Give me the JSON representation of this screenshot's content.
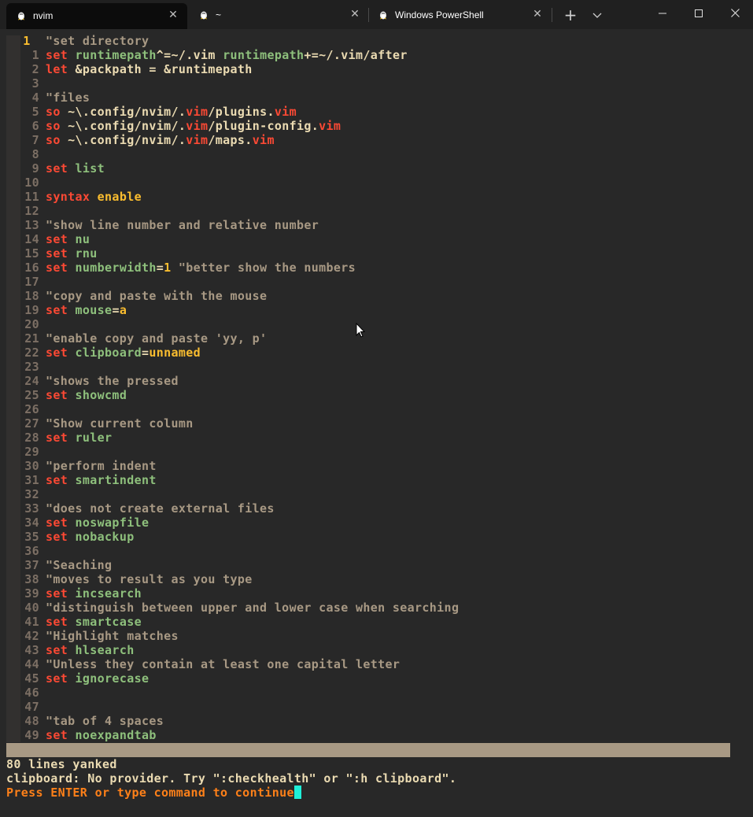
{
  "tabs": [
    {
      "label": "nvim",
      "active": true
    },
    {
      "label": "~",
      "active": false
    },
    {
      "label": "Windows PowerShell",
      "active": false
    }
  ],
  "colors": {
    "comment": "#a89984",
    "keyword": "#fb4934",
    "option": "#8ec07c",
    "value": "#fabd2f",
    "plain": "#ebdbb2",
    "linenr": "#7c6f64",
    "cursor": "#1ff0d8"
  },
  "editor": {
    "lines": [
      {
        "n": "1",
        "current": true,
        "parts": [
          [
            "c",
            "\"set directory"
          ]
        ]
      },
      {
        "n": "1",
        "parts": [
          [
            "k",
            "set "
          ],
          [
            "o",
            "runtimepath"
          ],
          [
            "p",
            "^=~/.vim "
          ],
          [
            "o",
            "runtimepath"
          ],
          [
            "p",
            "+=~/.vim/after"
          ]
        ]
      },
      {
        "n": "2",
        "parts": [
          [
            "k",
            "let "
          ],
          [
            "p",
            "&packpath = &runtimepath"
          ]
        ]
      },
      {
        "n": "3",
        "parts": []
      },
      {
        "n": "4",
        "parts": [
          [
            "c",
            "\"files"
          ]
        ]
      },
      {
        "n": "5",
        "parts": [
          [
            "k",
            "so "
          ],
          [
            "p",
            "~\\.config/nvim/."
          ],
          [
            "k",
            "vim"
          ],
          [
            "p",
            "/plugins."
          ],
          [
            "k",
            "vim"
          ]
        ]
      },
      {
        "n": "6",
        "parts": [
          [
            "k",
            "so "
          ],
          [
            "p",
            "~\\.config/nvim/."
          ],
          [
            "k",
            "vim"
          ],
          [
            "p",
            "/plugin-config."
          ],
          [
            "k",
            "vim"
          ]
        ]
      },
      {
        "n": "7",
        "parts": [
          [
            "k",
            "so "
          ],
          [
            "p",
            "~\\.config/nvim/."
          ],
          [
            "k",
            "vim"
          ],
          [
            "p",
            "/maps."
          ],
          [
            "k",
            "vim"
          ]
        ]
      },
      {
        "n": "8",
        "parts": []
      },
      {
        "n": "9",
        "parts": [
          [
            "k",
            "set "
          ],
          [
            "o",
            "list"
          ]
        ]
      },
      {
        "n": "10",
        "parts": []
      },
      {
        "n": "11",
        "parts": [
          [
            "k",
            "syntax "
          ],
          [
            "v",
            "enable"
          ]
        ]
      },
      {
        "n": "12",
        "parts": []
      },
      {
        "n": "13",
        "parts": [
          [
            "c",
            "\"show line number and relative number"
          ]
        ]
      },
      {
        "n": "14",
        "parts": [
          [
            "k",
            "set "
          ],
          [
            "o",
            "nu"
          ]
        ]
      },
      {
        "n": "15",
        "parts": [
          [
            "k",
            "set "
          ],
          [
            "o",
            "rnu"
          ]
        ]
      },
      {
        "n": "16",
        "parts": [
          [
            "k",
            "set "
          ],
          [
            "o",
            "numberwidth"
          ],
          [
            "p",
            "="
          ],
          [
            "v",
            "1"
          ],
          [
            "c",
            " \"better show the numbers"
          ]
        ]
      },
      {
        "n": "17",
        "parts": []
      },
      {
        "n": "18",
        "parts": [
          [
            "c",
            "\"copy and paste with the mouse"
          ]
        ]
      },
      {
        "n": "19",
        "parts": [
          [
            "k",
            "set "
          ],
          [
            "o",
            "mouse"
          ],
          [
            "p",
            "="
          ],
          [
            "v",
            "a"
          ]
        ]
      },
      {
        "n": "20",
        "parts": []
      },
      {
        "n": "21",
        "parts": [
          [
            "c",
            "\"enable copy and paste 'yy, p'"
          ]
        ]
      },
      {
        "n": "22",
        "parts": [
          [
            "k",
            "set "
          ],
          [
            "o",
            "clipboard"
          ],
          [
            "p",
            "="
          ],
          [
            "v",
            "unnamed"
          ]
        ]
      },
      {
        "n": "23",
        "parts": []
      },
      {
        "n": "24",
        "parts": [
          [
            "c",
            "\"shows the pressed"
          ]
        ]
      },
      {
        "n": "25",
        "parts": [
          [
            "k",
            "set "
          ],
          [
            "o",
            "showcmd"
          ]
        ]
      },
      {
        "n": "26",
        "parts": []
      },
      {
        "n": "27",
        "parts": [
          [
            "c",
            "\"Show current column"
          ]
        ]
      },
      {
        "n": "28",
        "parts": [
          [
            "k",
            "set "
          ],
          [
            "o",
            "ruler"
          ]
        ]
      },
      {
        "n": "29",
        "parts": []
      },
      {
        "n": "30",
        "parts": [
          [
            "c",
            "\"perform indent"
          ]
        ]
      },
      {
        "n": "31",
        "parts": [
          [
            "k",
            "set "
          ],
          [
            "o",
            "smartindent"
          ]
        ]
      },
      {
        "n": "32",
        "parts": []
      },
      {
        "n": "33",
        "parts": [
          [
            "c",
            "\"does not create external files"
          ]
        ]
      },
      {
        "n": "34",
        "parts": [
          [
            "k",
            "set "
          ],
          [
            "o",
            "noswapfile"
          ]
        ]
      },
      {
        "n": "35",
        "parts": [
          [
            "k",
            "set "
          ],
          [
            "o",
            "nobackup"
          ]
        ]
      },
      {
        "n": "36",
        "parts": []
      },
      {
        "n": "37",
        "parts": [
          [
            "c",
            "\"Seaching"
          ]
        ]
      },
      {
        "n": "38",
        "parts": [
          [
            "c",
            "\"moves to result as you type"
          ]
        ]
      },
      {
        "n": "39",
        "parts": [
          [
            "k",
            "set "
          ],
          [
            "o",
            "incsearch"
          ]
        ]
      },
      {
        "n": "40",
        "parts": [
          [
            "c",
            "\"distinguish between upper and lower case when searching"
          ]
        ]
      },
      {
        "n": "41",
        "parts": [
          [
            "k",
            "set "
          ],
          [
            "o",
            "smartcase"
          ]
        ]
      },
      {
        "n": "42",
        "parts": [
          [
            "c",
            "\"Highlight matches"
          ]
        ]
      },
      {
        "n": "43",
        "parts": [
          [
            "k",
            "set "
          ],
          [
            "o",
            "hlsearch"
          ]
        ]
      },
      {
        "n": "44",
        "parts": [
          [
            "c",
            "\"Unless they contain at least one capital letter"
          ]
        ]
      },
      {
        "n": "45",
        "parts": [
          [
            "k",
            "set "
          ],
          [
            "o",
            "ignorecase"
          ]
        ]
      },
      {
        "n": "46",
        "parts": []
      },
      {
        "n": "47",
        "parts": []
      },
      {
        "n": "48",
        "parts": [
          [
            "c",
            "\"tab of 4 spaces"
          ]
        ]
      },
      {
        "n": "49",
        "parts": [
          [
            "k",
            "set "
          ],
          [
            "o",
            "noexpandtab"
          ]
        ]
      }
    ]
  },
  "messages": {
    "line1": "80 lines yanked",
    "line2": "clipboard: No provider. Try \":checkhealth\" or \":h clipboard\".",
    "line3": "Press ENTER or type command to continue"
  }
}
